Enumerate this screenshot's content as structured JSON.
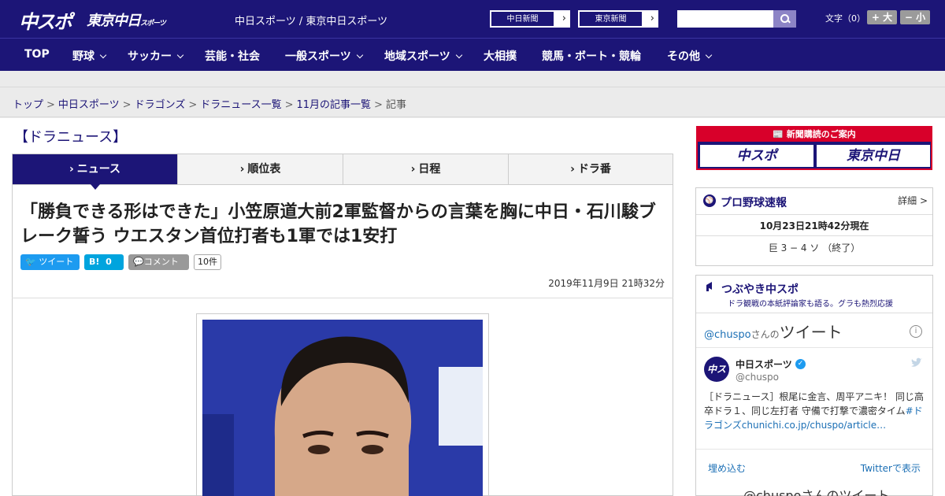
{
  "header": {
    "logo_main": "中スポ",
    "logo_tokyo": "東京中日",
    "logo_tokyo_small": "スポーツ",
    "site_links": "中日スポーツ / 東京中日スポーツ",
    "paper_links": [
      "中日新聞",
      "東京新聞"
    ],
    "search_placeholder": "",
    "font_size_label": "文字（0）",
    "font_bigger": "+ 大",
    "font_smaller": "− 小"
  },
  "nav": {
    "items": [
      {
        "label": "TOP",
        "has_menu": false
      },
      {
        "label": "野球",
        "has_menu": true
      },
      {
        "label": "サッカー",
        "has_menu": true
      },
      {
        "label": "芸能・社会",
        "has_menu": false
      },
      {
        "label": "一般スポーツ",
        "has_menu": true
      },
      {
        "label": "地域スポーツ",
        "has_menu": true
      },
      {
        "label": "大相撲",
        "has_menu": false
      },
      {
        "label": "競馬・ボート・競輪",
        "has_menu": false
      },
      {
        "label": "その他",
        "has_menu": true
      }
    ]
  },
  "breadcrumb": {
    "items": [
      "トップ",
      "中日スポーツ",
      "ドラゴンズ",
      "ドラニュース一覧",
      "11月の記事一覧"
    ],
    "current": "記事"
  },
  "main": {
    "section_title": "【ドラニュース】",
    "tabs": [
      "ニュース",
      "順位表",
      "日程",
      "ドラ番"
    ],
    "active_tab": 0,
    "headline": "「勝負できる形はできた」小笠原道大前2軍監督からの言葉を胸に中日・石川駿ブレーク誓う ウエスタン首位打者も1軍では1安打",
    "share": {
      "tweet": "ツイート",
      "hatena": "B!",
      "hatena_count": "0",
      "comment": "コメント",
      "comment_count": "10件"
    },
    "timestamp": "2019年11月9日 21時32分"
  },
  "sidebar": {
    "promo": {
      "title": "新聞購読のご案内",
      "buttons": [
        "中スポ",
        "東京中日"
      ]
    },
    "scores": {
      "title": "プロ野球速報",
      "more": "詳細 >",
      "updated": "10月23日21時42分現在",
      "result": "巨 3 − 4 ソ （終了）"
    },
    "twitter": {
      "title": "つぶやき中スポ",
      "subtitle": "ドラ観戦の本紙評論家も語る。グラも熱烈応援",
      "handle": "@chuspo",
      "handle_suffix": "さんの",
      "handle_big": "ツイート",
      "account_name": "中日スポーツ",
      "screen_name": "@chuspo",
      "tweet_text": "［ドラニュース］根尾に金言、周平アニキ！ 同じ高卒ドラ１、同じ左打者 守備で打撃で濃密タイム",
      "tweet_link": "#ドラゴンズchunichi.co.jp/chuspo/article…",
      "embed": "埋め込む",
      "view_on": "Twitterで表示",
      "next_header": "@chuspoさんのツイート"
    }
  },
  "colors": {
    "brand": "#1c1577",
    "accent_red": "#d8002a",
    "tweet_blue": "#1d9bf0",
    "hatena_blue": "#00a4de",
    "comment_gray": "#999999"
  }
}
